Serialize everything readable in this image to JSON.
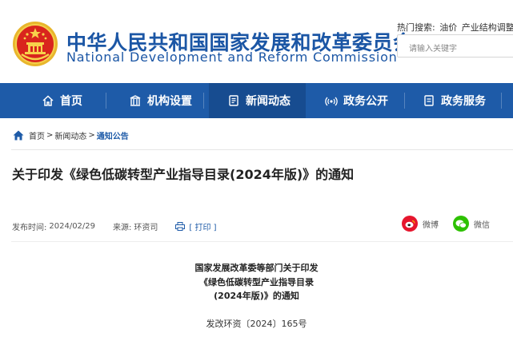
{
  "site": {
    "title_cn": "中华人民共和国国家发展和改革委员会",
    "title_en": "National Development and Reform Commission"
  },
  "search": {
    "hot_label": "热门搜索:",
    "hot_links": [
      "油价",
      "产业结构调整指"
    ],
    "placeholder": "请输入关键字"
  },
  "nav": {
    "items": [
      {
        "label": "首页",
        "icon": "home-icon"
      },
      {
        "label": "机构设置",
        "icon": "building-icon"
      },
      {
        "label": "新闻动态",
        "icon": "news-icon"
      },
      {
        "label": "政务公开",
        "icon": "broadcast-icon"
      },
      {
        "label": "政务服务",
        "icon": "document-icon"
      }
    ],
    "active": "新闻动态"
  },
  "breadcrumb": {
    "items": [
      "首页",
      "新闻动态",
      "通知公告"
    ],
    "separator": ">"
  },
  "article": {
    "title": "关于印发《绿色低碳转型产业指导目录(2024年版)》的通知",
    "published_label": "发布时间:",
    "published_date": "2024/02/29",
    "source_label": "来源:",
    "source": "环资司",
    "print_label": "[ 打印 ]"
  },
  "share": {
    "weibo": "微博",
    "wechat": "微信"
  },
  "body": {
    "heading_line1": "国家发展改革委等部门关于印发",
    "heading_line2": "《绿色低碳转型产业指导目录",
    "heading_line3": "(2024年版)》的通知",
    "doc_number": "发改环资〔2024〕165号"
  },
  "colors": {
    "brand_blue": "#1e5ba8",
    "nav_active": "#174c90",
    "weibo_red": "#e6162d",
    "wechat_green": "#2dc100"
  }
}
